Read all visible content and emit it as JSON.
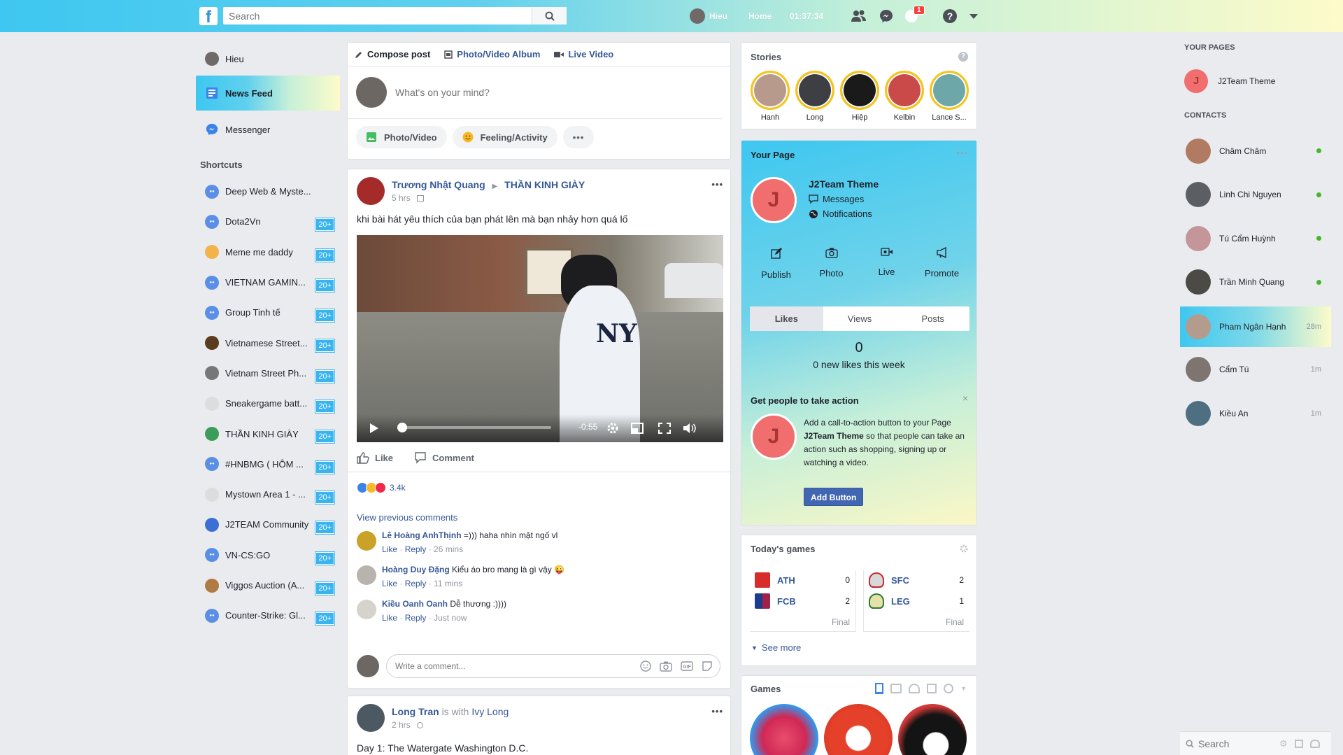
{
  "topbar": {
    "logo": "f",
    "search_placeholder": "Search",
    "user_name": "Hieu",
    "home": "Home",
    "clock": "01:37:34",
    "notif_count": "1"
  },
  "left": {
    "profile": "Hieu",
    "news_feed": "News Feed",
    "messenger": "Messenger",
    "shortcuts_title": "Shortcuts",
    "shortcuts": [
      {
        "label": "Deep Web & Myste...",
        "badge": ""
      },
      {
        "label": "Dota2Vn",
        "badge": "20+"
      },
      {
        "label": "Meme me daddy",
        "badge": "20+"
      },
      {
        "label": "VIETNAM GAMIN...",
        "badge": "20+"
      },
      {
        "label": "Group Tinh tế",
        "badge": "20+"
      },
      {
        "label": "Vietnamese Street...",
        "badge": "20+"
      },
      {
        "label": "Vietnam Street Ph...",
        "badge": "20+"
      },
      {
        "label": "Sneakergame batt...",
        "badge": "20+"
      },
      {
        "label": "THẦN KINH GIÀY",
        "badge": "20+"
      },
      {
        "label": "#HNBMG ( HÔM ...",
        "badge": "20+"
      },
      {
        "label": "Mystown Area 1 - ...",
        "badge": "20+"
      },
      {
        "label": "J2TEAM Community",
        "badge": "20+"
      },
      {
        "label": "VN-CS:GO",
        "badge": "20+"
      },
      {
        "label": "Viggos Auction (A...",
        "badge": "20+"
      },
      {
        "label": "Counter-Strike: Gl...",
        "badge": "20+"
      }
    ]
  },
  "composer": {
    "tab_compose": "Compose post",
    "tab_album": "Photo/Video Album",
    "tab_live": "Live Video",
    "placeholder": "What's on your mind?",
    "btn_photo": "Photo/Video",
    "btn_feeling": "Feeling/Activity",
    "btn_more": "•••"
  },
  "post1": {
    "author": "Trương Nhật Quang",
    "target": "THẦN KINH GIÀY",
    "time": "5 hrs",
    "text": "khi bài hát yêu thích của bạn phát lên mà bạn nhảy hơn quá lố",
    "video_time": "-0:55",
    "video_progress": 0.03,
    "like": "Like",
    "comment": "Comment",
    "reaction_count": "3.4k",
    "view_previous": "View previous comments",
    "comments": [
      {
        "author": "Lê Hoàng AnhThịnh",
        "text": "=))) haha nhìn mặt ngố vl",
        "like": "Like",
        "reply": "Reply",
        "time": "26 mins"
      },
      {
        "author": "Hoàng Duy Đặng",
        "text": "Kiểu áo bro mang là gì vậy 😜",
        "like": "Like",
        "reply": "Reply",
        "time": "11 mins"
      },
      {
        "author": "Kiều Oanh Oanh",
        "text": "Dễ thương :))))",
        "like": "Like",
        "reply": "Reply",
        "time": "Just now"
      }
    ],
    "write_placeholder": "Write a comment..."
  },
  "post2": {
    "author": "Long Tran",
    "with_text": "is with",
    "with_name": "Ivy Long",
    "time": "2 hrs",
    "text": "Day 1: The Watergate Washington D.C."
  },
  "stories": {
    "title": "Stories",
    "items": [
      {
        "name": "Hanh",
        "color": "#b79a8c"
      },
      {
        "name": "Long",
        "color": "#3d3f44"
      },
      {
        "name": "Hiệp",
        "color": "#1a1a1a"
      },
      {
        "name": "Kelbin",
        "color": "#c94a48"
      },
      {
        "name": "Lance S...",
        "color": "#6ea7a7"
      }
    ]
  },
  "your_page": {
    "title": "Your Page",
    "more": "•••",
    "page_name": "J2Team Theme",
    "messages": "Messages",
    "notifications": "Notifications",
    "initial": "J",
    "actions": [
      "Publish",
      "Photo",
      "Live",
      "Promote"
    ],
    "tabs": [
      "Likes",
      "Views",
      "Posts"
    ],
    "likes_count": "0",
    "likes_text": "0 new likes this week",
    "cta_title": "Get people to take action",
    "cta_text_1": "Add a call-to-action button to your Page",
    "cta_page": "J2Team Theme",
    "cta_text_2": "so that people can take an action such as shopping, signing up or watching a video.",
    "cta_button": "Add Button"
  },
  "games_today": {
    "title": "Today's games",
    "match1": {
      "team1": "ATH",
      "score1": "0",
      "team2": "FCB",
      "score2": "2",
      "status": "Final"
    },
    "match2": {
      "team1": "SFC",
      "score1": "2",
      "team2": "LEG",
      "score2": "1",
      "status": "Final"
    },
    "see_more": "See more"
  },
  "games": {
    "title": "Games"
  },
  "rightbar": {
    "your_pages": "YOUR PAGES",
    "page_name": "J2Team Theme",
    "contacts_title": "CONTACTS",
    "contacts": [
      {
        "name": "Châm Châm",
        "status": "online",
        "ago": "",
        "color": "#b07b62"
      },
      {
        "name": "Linh Chi Nguyen",
        "status": "online",
        "ago": "",
        "color": "#5b5e63"
      },
      {
        "name": "Tú Cẩm Huỳnh",
        "status": "online",
        "ago": "",
        "color": "#c4969a"
      },
      {
        "name": "Trần Minh Quang",
        "status": "online",
        "ago": "",
        "color": "#4c4a45"
      },
      {
        "name": "Pham Ngân Hạnh",
        "status": "away",
        "ago": "28m",
        "color": "#b39b8e"
      },
      {
        "name": "Cẩm Tú",
        "status": "away",
        "ago": "1m",
        "color": "#7e7570"
      },
      {
        "name": "Kiều An",
        "status": "away",
        "ago": "1m",
        "color": "#4e6e82"
      }
    ],
    "search_placeholder": "Search"
  }
}
